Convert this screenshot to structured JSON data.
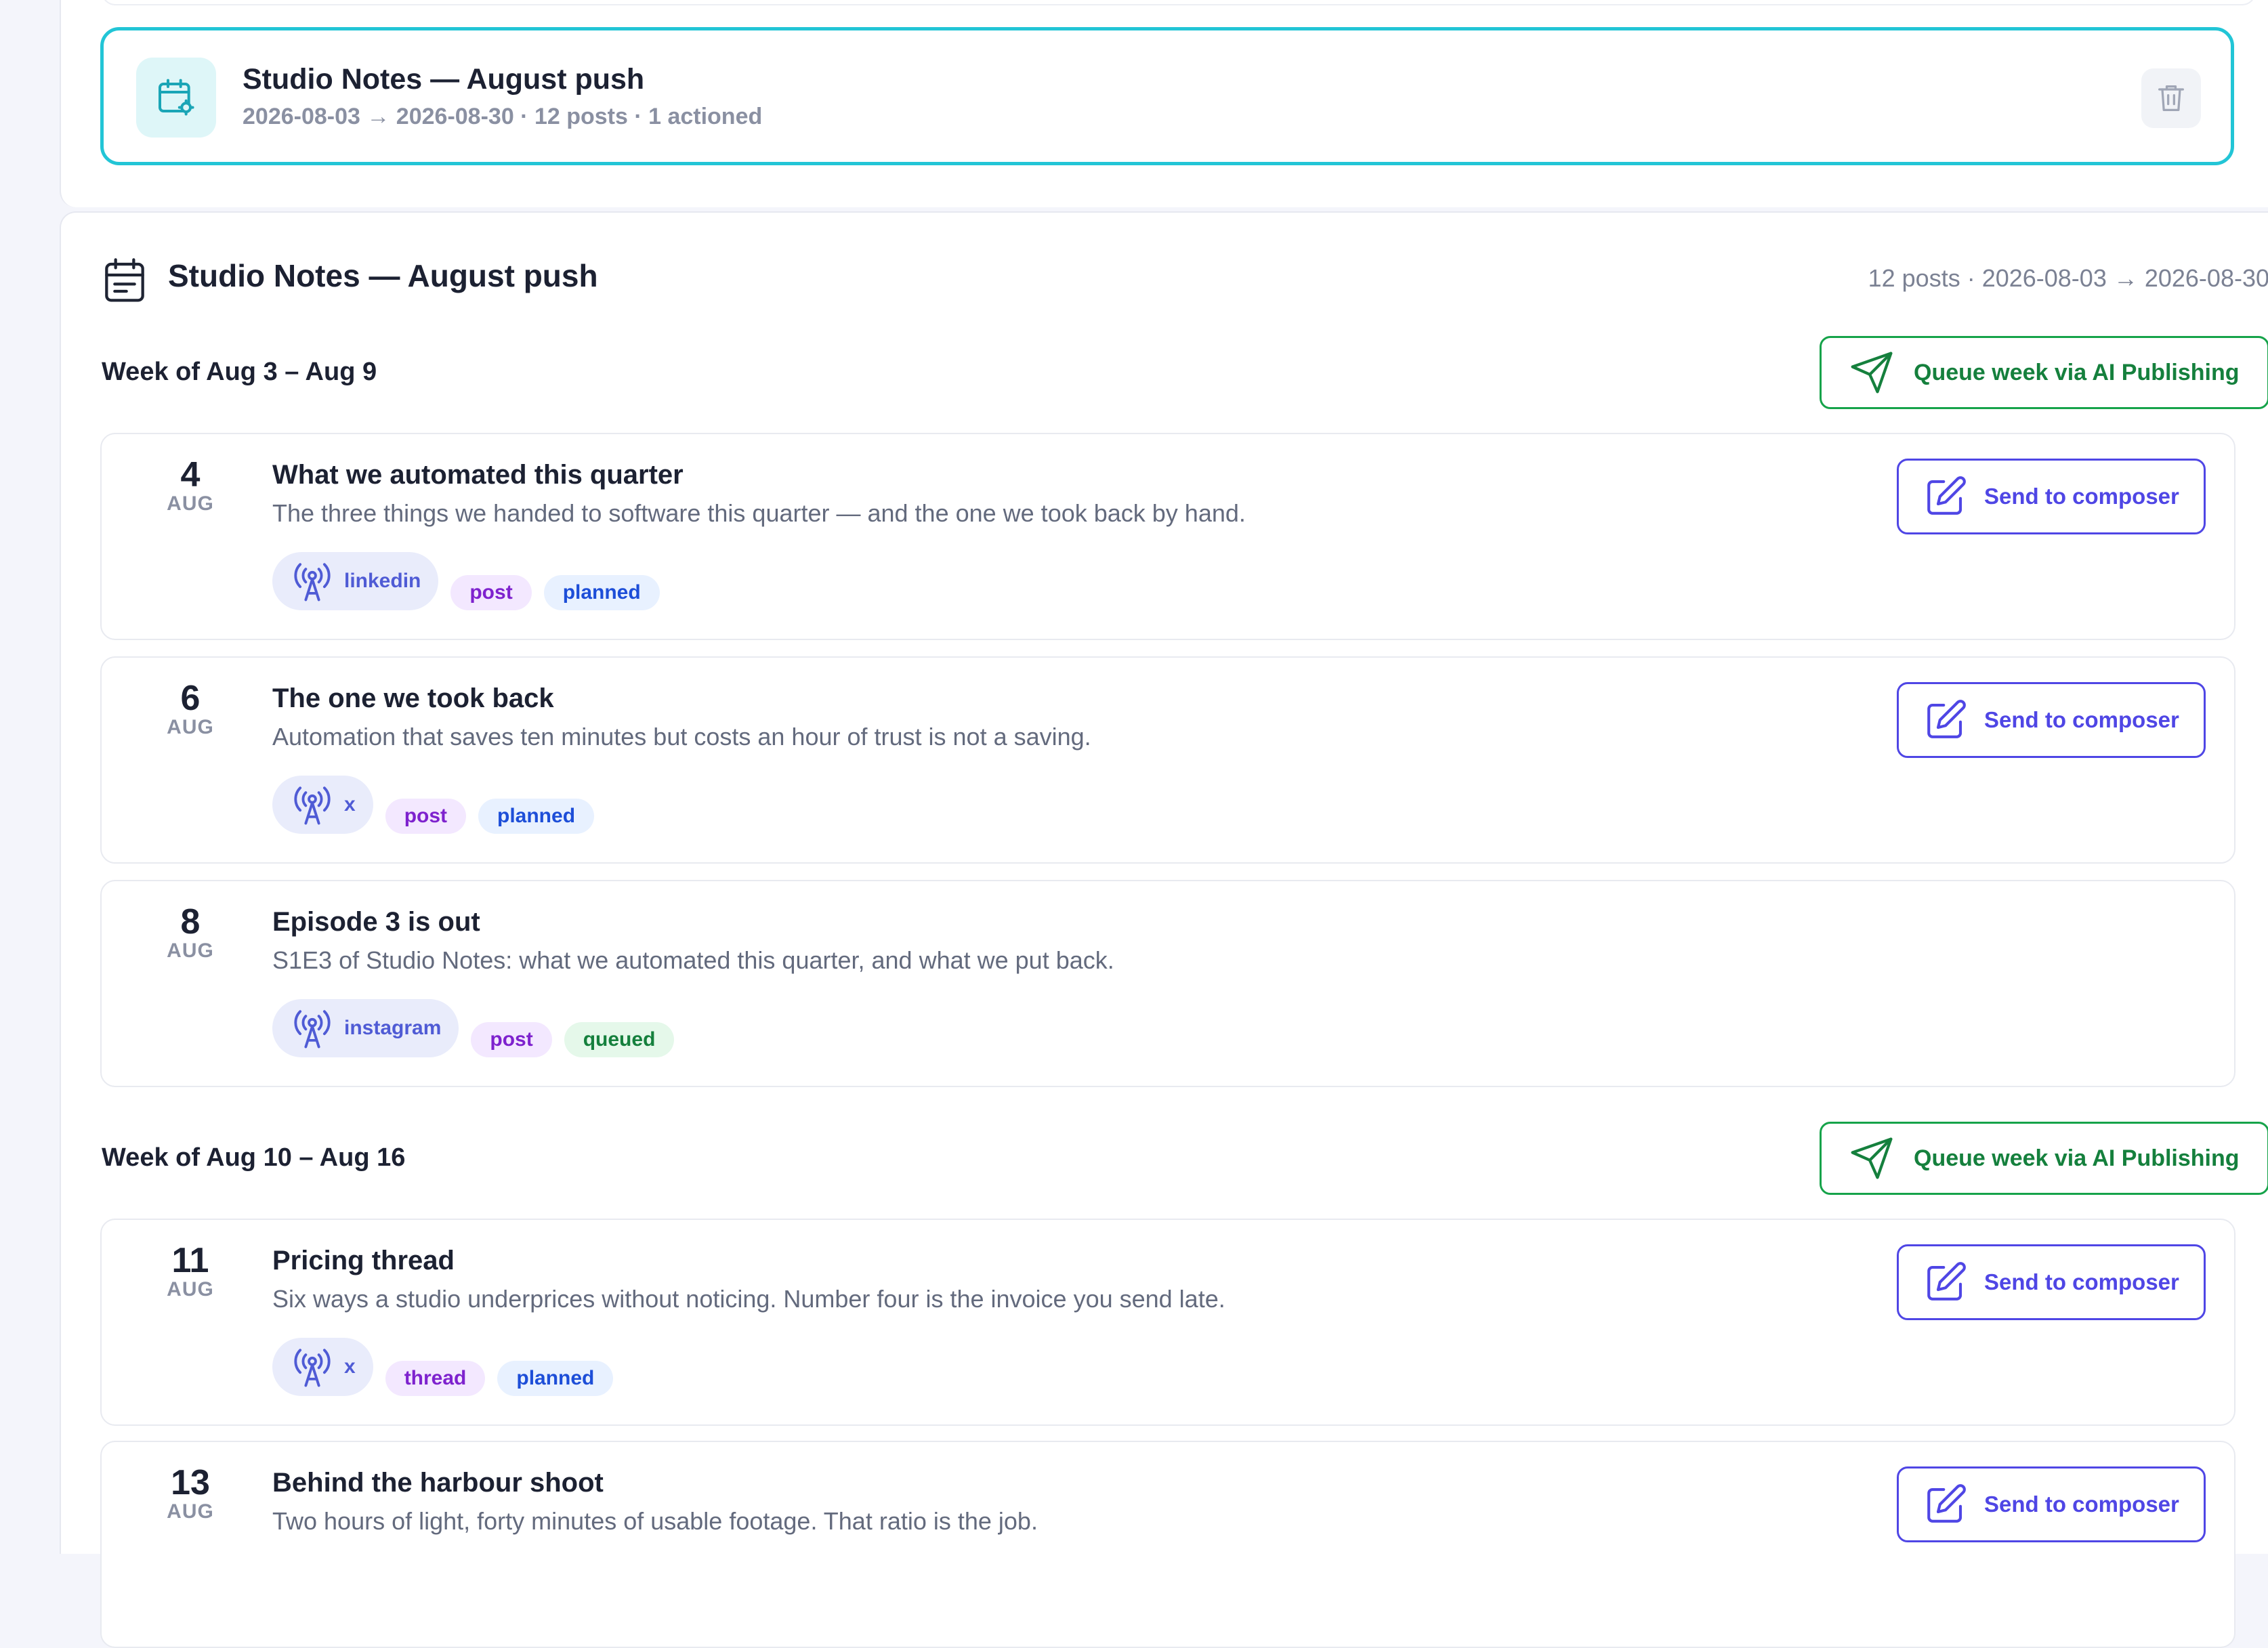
{
  "campaign_card": {
    "title": "Studio Notes — August push",
    "meta": "2026-08-03 → 2026-08-30 · 12 posts · 1 actioned"
  },
  "calendar": {
    "title": "Studio Notes — August push",
    "meta": "12 posts · 2026-08-03 → 2026-08-30",
    "queue_label": "Queue week via AI Publishing",
    "compose_label": "Send to composer",
    "weeks": [
      {
        "label": "Week of Aug 3 – Aug 9"
      },
      {
        "label": "Week of Aug 10 – Aug 16"
      }
    ],
    "posts": [
      {
        "day": "4",
        "month": "AUG",
        "title": "What we automated this quarter",
        "desc": "The three things we handed to software this quarter — and the one we took back by hand.",
        "channel": "linkedin",
        "type": "post",
        "status": "planned"
      },
      {
        "day": "6",
        "month": "AUG",
        "title": "The one we took back",
        "desc": "Automation that saves ten minutes but costs an hour of trust is not a saving.",
        "channel": "x",
        "type": "post",
        "status": "planned"
      },
      {
        "day": "8",
        "month": "AUG",
        "title": "Episode 3 is out",
        "desc": "S1E3 of Studio Notes: what we automated this quarter, and what we put back.",
        "channel": "instagram",
        "type": "post",
        "status": "queued"
      },
      {
        "day": "11",
        "month": "AUG",
        "title": "Pricing thread",
        "desc": "Six ways a studio underprices without noticing. Number four is the invoice you send late.",
        "channel": "x",
        "type": "thread",
        "status": "planned"
      },
      {
        "day": "13",
        "month": "AUG",
        "title": "Behind the harbour shoot",
        "desc": "Two hours of light, forty minutes of usable footage. That ratio is the job."
      }
    ]
  },
  "colors": {
    "accent_teal": "#22c5d6",
    "queue_green": "#16a34a",
    "compose_indigo": "#4f46e5",
    "type_purple": "#7e22ce",
    "planned_blue": "#1d4ed8",
    "queued_green": "#15803d"
  },
  "icons": {
    "campaign": "calendar-gear-icon",
    "delete": "trash-icon",
    "header": "calendar-icon",
    "queue": "send-icon",
    "compose": "edit-icon",
    "channel": "broadcast-icon"
  }
}
